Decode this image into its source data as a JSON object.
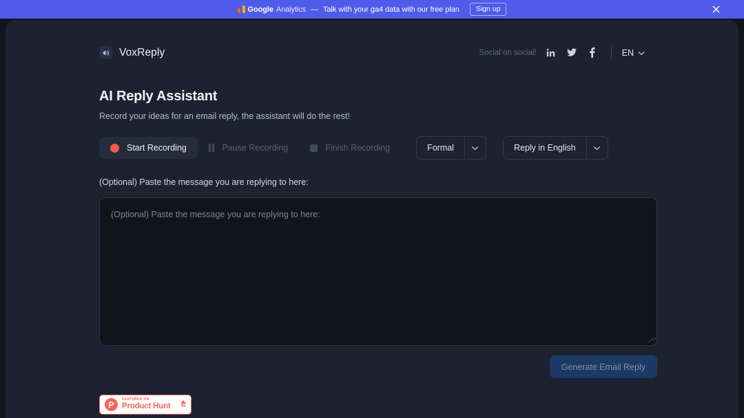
{
  "banner": {
    "brand_word": "Google",
    "brand_sub": "Analytics",
    "dash": "—",
    "text": "Talk with your ga4 data with our free plan",
    "signup_label": "Sign up",
    "close_icon": "close-icon",
    "background": "#4f5bea"
  },
  "header": {
    "brand_name": "VoxReply",
    "logo_icon": "speaker-icon",
    "social_label": "Social on social!",
    "social": [
      {
        "name": "linkedin-icon",
        "label": "in"
      },
      {
        "name": "twitter-icon",
        "label": "twitter"
      },
      {
        "name": "facebook-icon",
        "label": "f"
      }
    ],
    "language": "EN",
    "language_chevron": "chevron-down-icon"
  },
  "main": {
    "title": "AI Reply Assistant",
    "subtitle": "Record your ideas for an email reply, the assistant will do the rest!",
    "controls": {
      "start_label": "Start Recording",
      "pause_label": "Pause Recording",
      "finish_label": "Finish Recording",
      "tone_value": "Formal",
      "reply_language_value": "Reply in English"
    },
    "field_label": "(Optional) Paste the message you are replying to here:",
    "textarea_placeholder": "(Optional) Paste the message you are replying to here:",
    "textarea_value": "",
    "generate_label": "Generate Email Reply"
  },
  "product_hunt": {
    "featured_label": "FEATURED ON",
    "name": "Product Hunt",
    "upvotes": "45",
    "logo_letter": "P",
    "accent": "#f4655c"
  }
}
